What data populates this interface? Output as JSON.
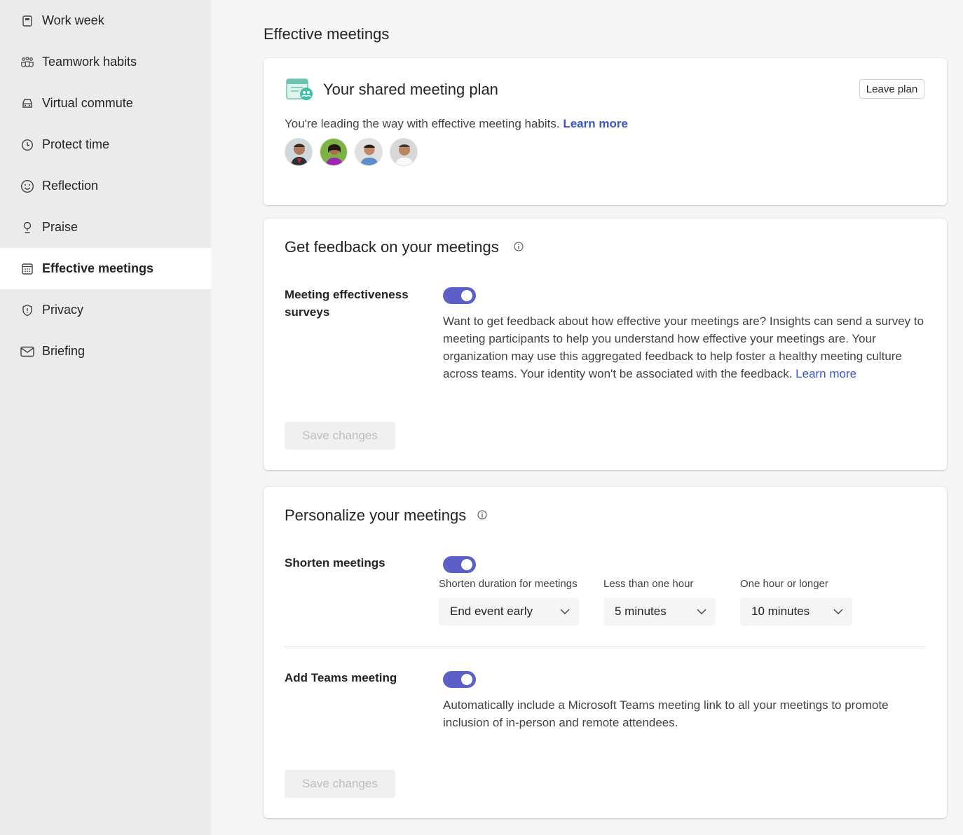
{
  "sidebar": {
    "items": [
      {
        "label": "Work week",
        "icon": "calendar-week-icon"
      },
      {
        "label": "Teamwork habits",
        "icon": "people-team-icon"
      },
      {
        "label": "Virtual commute",
        "icon": "car-icon"
      },
      {
        "label": "Protect time",
        "icon": "clock-icon"
      },
      {
        "label": "Reflection",
        "icon": "emoji-icon"
      },
      {
        "label": "Praise",
        "icon": "trophy-icon"
      },
      {
        "label": "Effective meetings",
        "icon": "calendar-grid-icon",
        "active": true
      },
      {
        "label": "Privacy",
        "icon": "shield-icon"
      },
      {
        "label": "Briefing",
        "icon": "mail-icon"
      }
    ]
  },
  "page": {
    "title": "Effective meetings"
  },
  "plan_card": {
    "title": "Your shared meeting plan",
    "leave_label": "Leave plan",
    "description": "You're leading the way with effective meeting habits.",
    "learn_more": "Learn more"
  },
  "feedback_card": {
    "title": "Get feedback on your meetings",
    "setting_label": "Meeting effectiveness surveys",
    "toggle_on": true,
    "description": "Want to get feedback about how effective your meetings are? Insights can send a survey to meeting participants to help you understand how effective your meetings are. Your organization may use this aggregated feedback to help foster a healthy meeting culture across teams. Your identity won't be associated with the feedback.",
    "learn_more": "Learn more",
    "save_label": "Save changes"
  },
  "personalize_card": {
    "title": "Personalize your meetings",
    "shorten": {
      "label": "Shorten meetings",
      "toggle_on": true,
      "duration_label": "Shorten duration for meetings",
      "duration_value": "End event early",
      "less_label": "Less than one hour",
      "less_value": "5 minutes",
      "longer_label": "One hour or longer",
      "longer_value": "10 minutes"
    },
    "teams": {
      "label": "Add Teams meeting",
      "toggle_on": true,
      "description": "Automatically include a Microsoft Teams meeting link to all your meetings to promote inclusion of in-person and remote attendees."
    },
    "save_label": "Save changes"
  },
  "colors": {
    "accent": "#5b5fc7",
    "link": "#3b55c4",
    "sidebar_bg": "#ebebeb"
  }
}
